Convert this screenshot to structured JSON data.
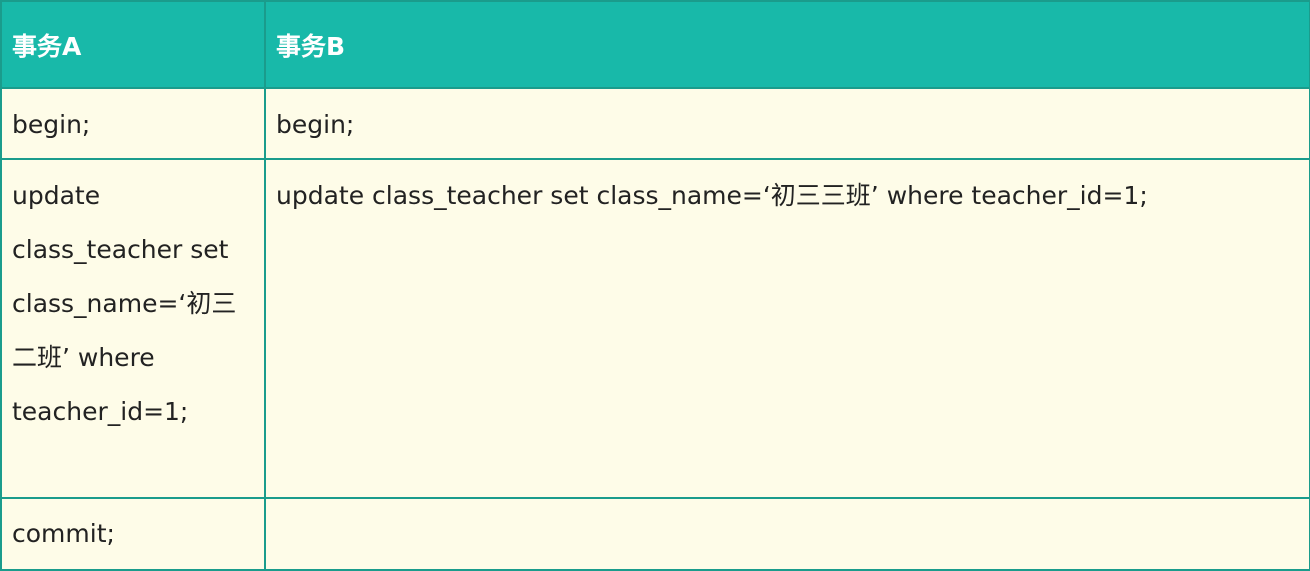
{
  "table": {
    "headers": [
      "事务A",
      "事务B"
    ],
    "rows": [
      {
        "a": "begin;",
        "b": "begin;"
      },
      {
        "a": "update class_teacher set class_name=‘初三二班’ where teacher_id=1;",
        "b": "update class_teacher set class_name=‘初三三班’ where teacher_id=1;"
      },
      {
        "a": "commit;",
        "b": ""
      }
    ]
  },
  "colors": {
    "header_bg": "#18b9a9",
    "header_text": "#ffffff",
    "cell_bg": "#fefce8",
    "border": "#1a9c8c"
  }
}
